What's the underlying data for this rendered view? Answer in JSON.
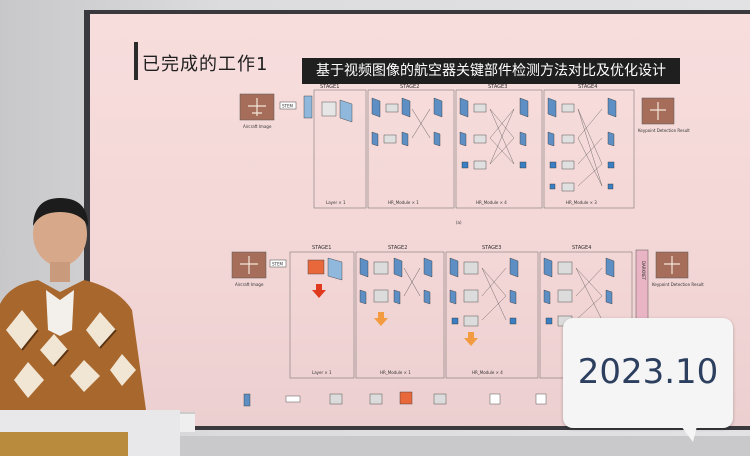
{
  "slide": {
    "title": "已完成的工作1",
    "subtitle": "基于视频图像的航空器关键部件检测方法对比及优化设计"
  },
  "diagram_top": {
    "stages": [
      "STAGE1",
      "STAGE2",
      "STAGE3",
      "STAGE4"
    ],
    "stem_label": "STEM",
    "input_caption": "Aircraft Image",
    "output_caption": "Keypoint Detection Result",
    "bottom_labels": [
      "Layer × 1",
      "HR_Module × 1",
      "HR_Module × 4",
      "HR_Module × 3"
    ],
    "caption": "(a)"
  },
  "diagram_bottom": {
    "stages": [
      "STAGE1",
      "STAGE2",
      "STAGE3",
      "STAGE4"
    ],
    "stem_label": "STEM",
    "input_caption": "Aircraft Image",
    "output_caption": "Keypoint Detection Result",
    "bottom_labels": [
      "Layer × 1",
      "HR_Module × 1",
      "HR_Module × 4",
      "HR_Module × 3"
    ],
    "darknet_label": "DARKNET"
  },
  "badge": {
    "date": "2023.10"
  },
  "colors": {
    "slide_bg": "#f5dada",
    "feature_map": "#5d8fc4",
    "arrow_red": "#e03a1e",
    "arrow_orange": "#f29b40"
  }
}
